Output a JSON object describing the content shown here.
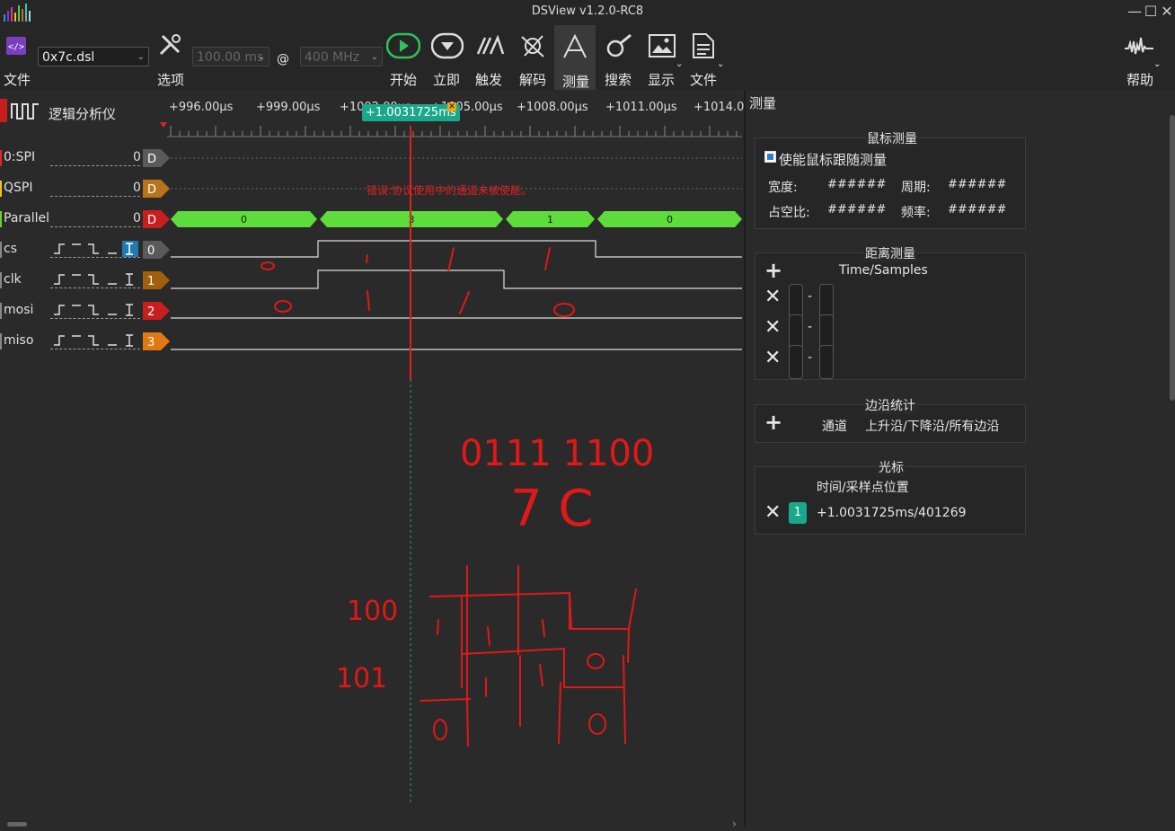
{
  "app": {
    "title": "DSView v1.2.0-RC8",
    "window_buttons": [
      "—",
      "☐",
      "✕"
    ]
  },
  "toolbar": {
    "file_label": "文件",
    "file_combo_value": "0x7c.dsl",
    "options_label": "选项",
    "duration_value": "100.00 ms",
    "at_symbol": "@",
    "rate_value": "400 MHz",
    "start_label": "开始",
    "instant_label": "立即",
    "trigger_label": "触发",
    "decode_label": "解码",
    "measure_label": "测量",
    "search_label": "搜索",
    "display_label": "显示",
    "file2_label": "文件",
    "help_label": "帮助"
  },
  "left": {
    "section_title": "逻辑分析仪",
    "channels": [
      {
        "name": "0:SPI",
        "value": "0",
        "tag": "D",
        "color": "#d62d2d",
        "tag_color": "#5a5a5a"
      },
      {
        "name": "QSPI",
        "value": "0",
        "tag": "D",
        "color": "#e8c22c",
        "tag_color": "#b8741a"
      },
      {
        "name": "Parallel",
        "value": "0",
        "tag": "D",
        "color": "#6fcf2f",
        "tag_color": "#c81e1e"
      },
      {
        "name": "cs",
        "value": "",
        "tag": "0",
        "color": "#888888",
        "tag_color": "#5a5a5a"
      },
      {
        "name": "clk",
        "value": "",
        "tag": "1",
        "color": "#888888",
        "tag_color": "#a0600c"
      },
      {
        "name": "mosi",
        "value": "",
        "tag": "2",
        "color": "#888888",
        "tag_color": "#c81e1e"
      },
      {
        "name": "miso",
        "value": "",
        "tag": "3",
        "color": "#888888",
        "tag_color": "#e07a10"
      }
    ]
  },
  "ruler": {
    "ticks": [
      "+996.00μs",
      "+999.00μs",
      "+1002.00μs",
      "+1005.00μs",
      "+1008.00μs",
      "+1011.00μs",
      "+1014.0"
    ],
    "cursor_label": "+1.0031725ms"
  },
  "wave": {
    "error_text": "错误:协议使用中的通道未被使能。",
    "parallel_segments": [
      "0",
      "3",
      "1",
      "0"
    ]
  },
  "right": {
    "header": "测量",
    "mouse": {
      "title": "鼠标测量",
      "checkbox_label": "使能鼠标跟随测量",
      "width_label": "宽度:",
      "width_value": "######",
      "period_label": "周期:",
      "period_value": "######",
      "duty_label": "占空比:",
      "duty_value": "######",
      "freq_label": "频率:",
      "freq_value": "######"
    },
    "distance": {
      "title": "距离测量",
      "column": "Time/Samples",
      "dash": "-"
    },
    "edge": {
      "title": "边沿统计",
      "channel_col": "通道",
      "edges_col": "上升沿/下降沿/所有边沿"
    },
    "cursor": {
      "title": "光标",
      "column": "时间/采样点位置",
      "index": "1",
      "value": "+1.0031725ms/401269"
    }
  },
  "handwriting": {
    "row1": "0111  1100",
    "row2": "7    C",
    "lbl1": "100",
    "lbl2": "101",
    "d1": "0",
    "d2": "0",
    "d3": "0",
    "d4": "0"
  },
  "colors": {
    "bg": "#2a2a2a",
    "accent_green": "#5ddc3b",
    "cursor_red": "#e02020",
    "teal": "#1aa88a",
    "annotation_red": "#e01818"
  }
}
